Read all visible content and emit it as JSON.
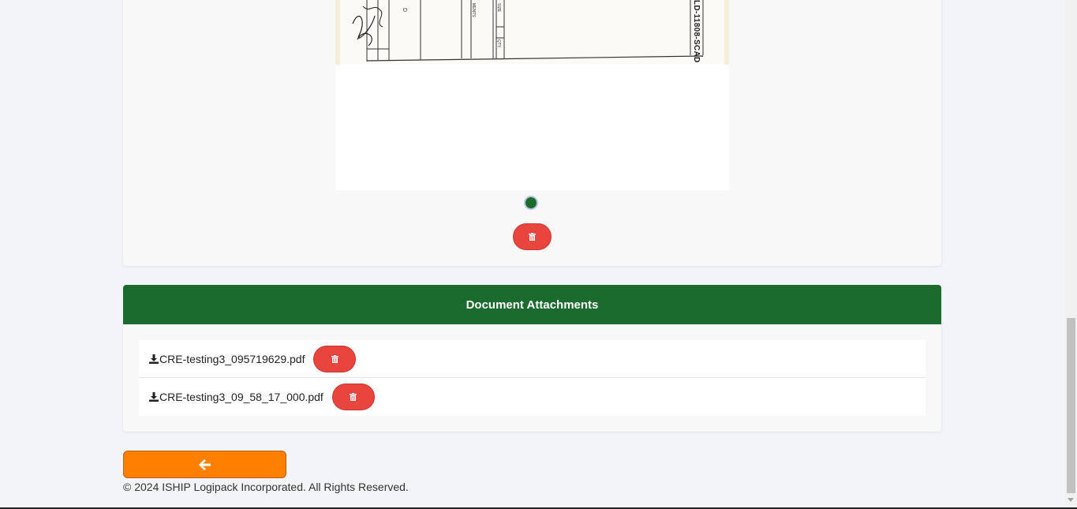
{
  "image_card": {
    "document_text": "LD-11808-SCAD",
    "carousel": {
      "active_index": 1,
      "total": 1
    },
    "delete_icon": "trash-icon"
  },
  "attachments": {
    "title": "Document Attachments",
    "files": [
      {
        "name": "CRE-testing3_095719629.pdf",
        "icon": "download-icon",
        "delete_icon": "trash-icon"
      },
      {
        "name": "CRE-testing3_09_58_17_000.pdf",
        "icon": "download-icon",
        "delete_icon": "trash-icon"
      }
    ]
  },
  "back_button": {
    "icon": "arrow-left-icon"
  },
  "footer": {
    "copyright": "© 2024 ISHIP Logipack Incorporated. All Rights Reserved."
  },
  "colors": {
    "header_green": "#1b6a2e",
    "delete_red": "#e8453c",
    "back_orange": "#ff7f00",
    "page_bg": "#f3f4f8"
  }
}
